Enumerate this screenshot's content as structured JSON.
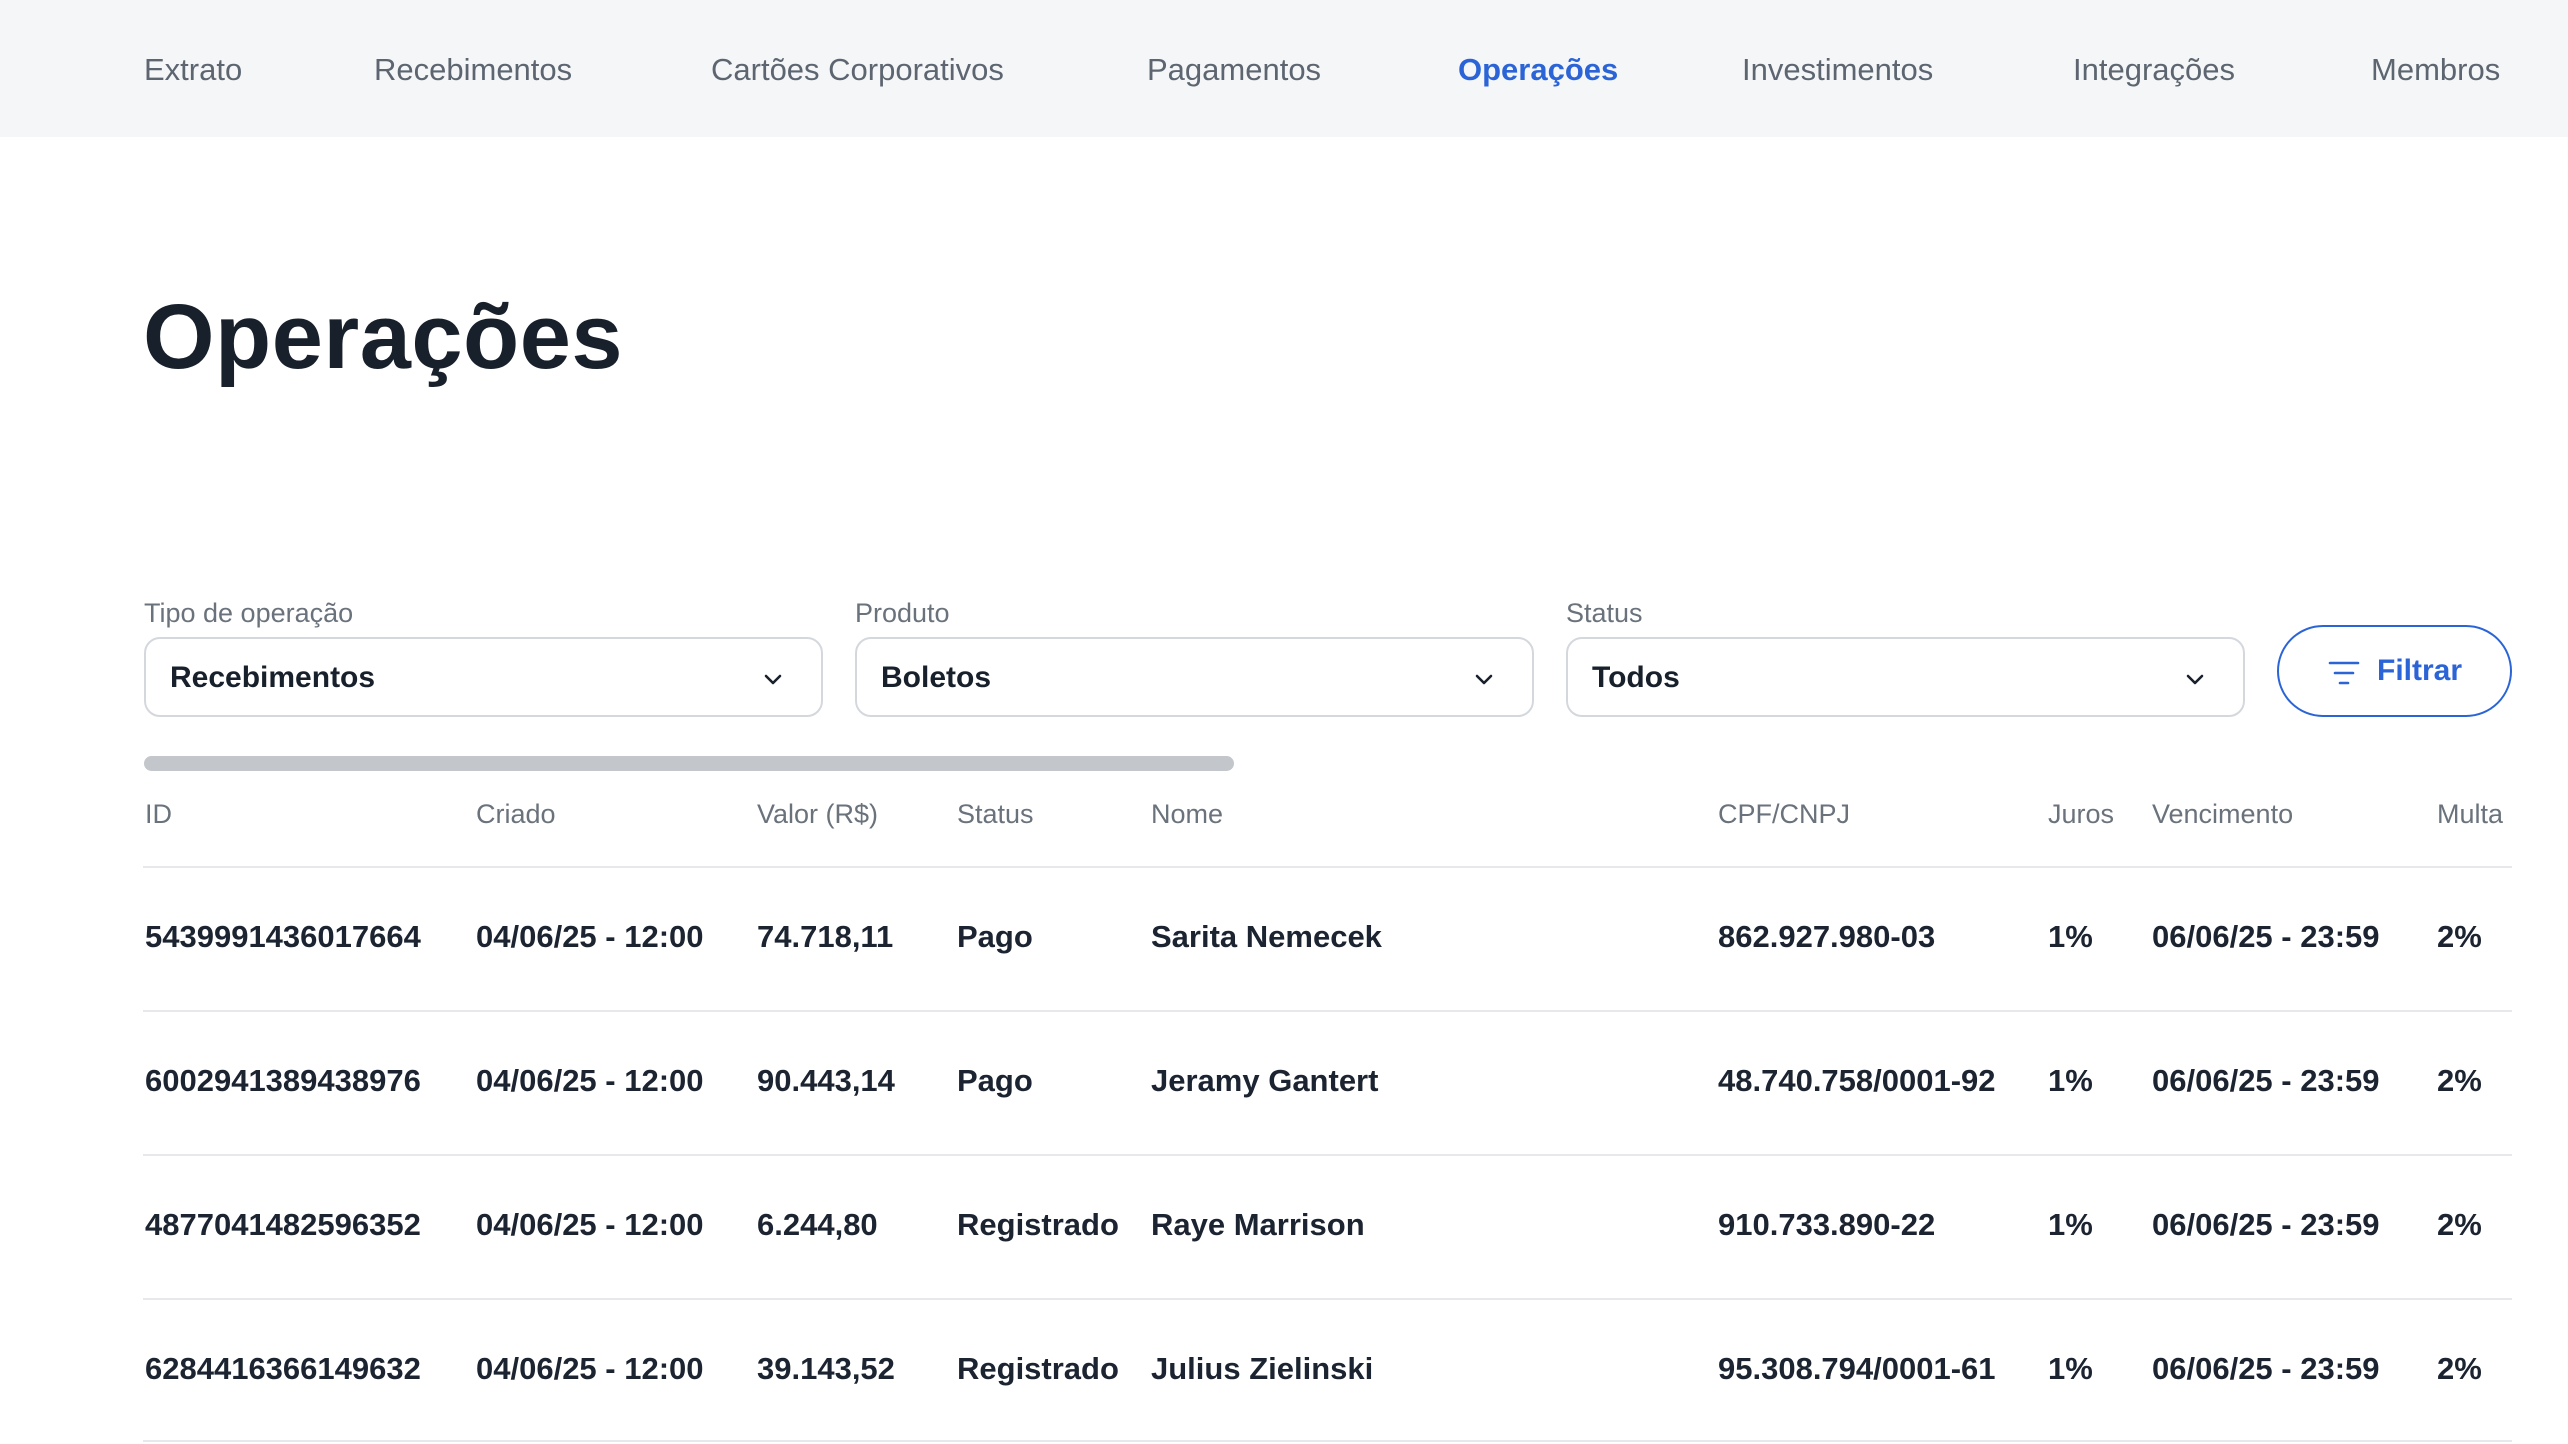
{
  "nav": {
    "items": [
      {
        "label": "Extrato"
      },
      {
        "label": "Recebimentos"
      },
      {
        "label": "Cartões Corporativos"
      },
      {
        "label": "Pagamentos"
      },
      {
        "label": "Operações",
        "active": true
      },
      {
        "label": "Investimentos"
      },
      {
        "label": "Integrações"
      },
      {
        "label": "Membros"
      }
    ]
  },
  "page": {
    "title": "Operações"
  },
  "filters": {
    "tipo": {
      "label": "Tipo de operação",
      "value": "Recebimentos"
    },
    "produto": {
      "label": "Produto",
      "value": "Boletos"
    },
    "status": {
      "label": "Status",
      "value": "Todos"
    },
    "button_label": "Filtrar"
  },
  "colors": {
    "accent": "#2b64d6",
    "text": "#17202b",
    "muted": "#6a727c"
  },
  "table": {
    "columns": [
      "ID",
      "Criado",
      "Valor (R$)",
      "Status",
      "Nome",
      "CPF/CNPJ",
      "Juros",
      "Vencimento",
      "Multa"
    ],
    "rows": [
      [
        "5439991436017664",
        "04/06/25 - 12:00",
        "74.718,11",
        "Pago",
        "Sarita Nemecek",
        "862.927.980-03",
        "1%",
        "06/06/25 - 23:59",
        "2%"
      ],
      [
        "6002941389438976",
        "04/06/25 - 12:00",
        "90.443,14",
        "Pago",
        "Jeramy Gantert",
        "48.740.758/0001-92",
        "1%",
        "06/06/25 - 23:59",
        "2%"
      ],
      [
        "4877041482596352",
        "04/06/25 - 12:00",
        "6.244,80",
        "Registrado",
        "Raye Marrison",
        "910.733.890-22",
        "1%",
        "06/06/25 - 23:59",
        "2%"
      ],
      [
        "6284416366149632",
        "04/06/25 - 12:00",
        "39.143,52",
        "Registrado",
        "Julius Zielinski",
        "95.308.794/0001-61",
        "1%",
        "06/06/25 - 23:59",
        "2%"
      ]
    ]
  }
}
